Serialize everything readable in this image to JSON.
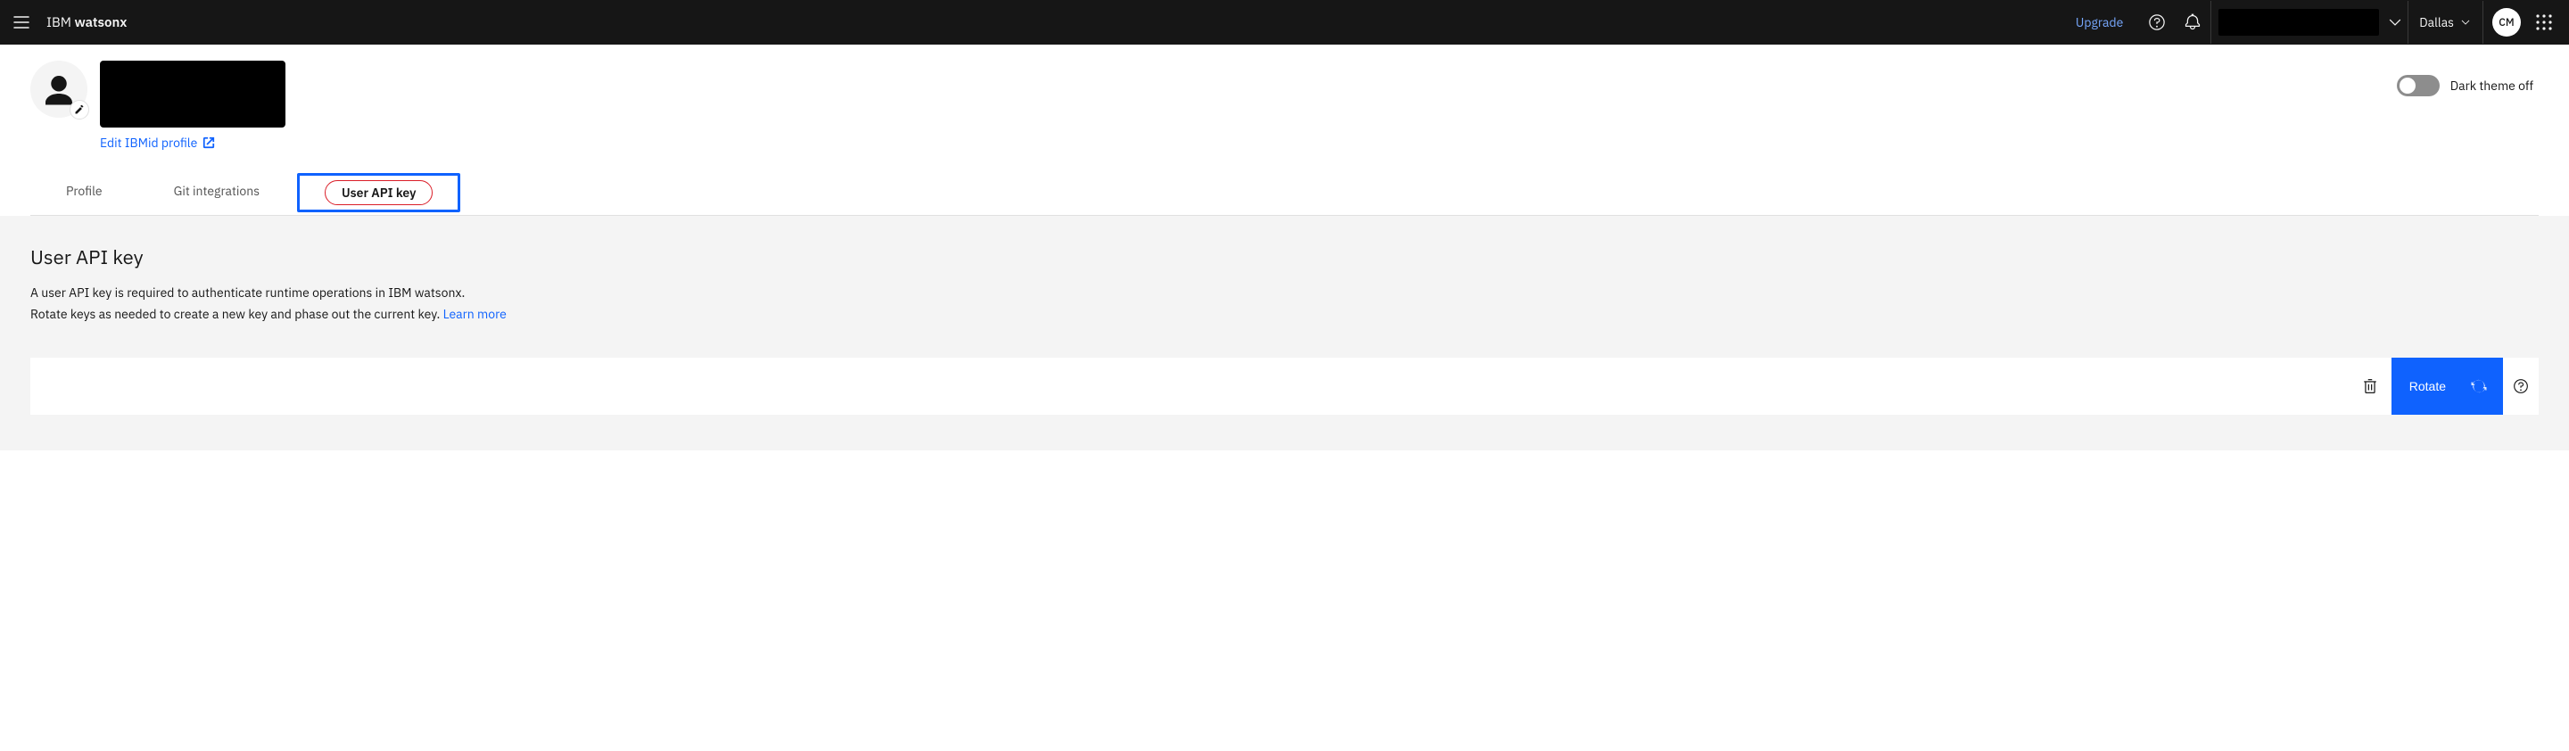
{
  "header": {
    "brand_light": "IBM ",
    "brand_bold": "watsonx",
    "upgrade": "Upgrade",
    "region": "Dallas",
    "avatar_initials": "CM"
  },
  "profile": {
    "edit_link": "Edit IBMid profile",
    "toggle_label": "Dark theme off"
  },
  "tabs": [
    {
      "label": "Profile"
    },
    {
      "label": "Git integrations"
    },
    {
      "label": "User API key"
    }
  ],
  "main": {
    "heading": "User API key",
    "p1": "A user API key is required to authenticate runtime operations in IBM watsonx.",
    "p2a": "Rotate keys as needed to create a new key and phase out the current key. ",
    "learn_more": "Learn more",
    "rotate_label": "Rotate"
  }
}
